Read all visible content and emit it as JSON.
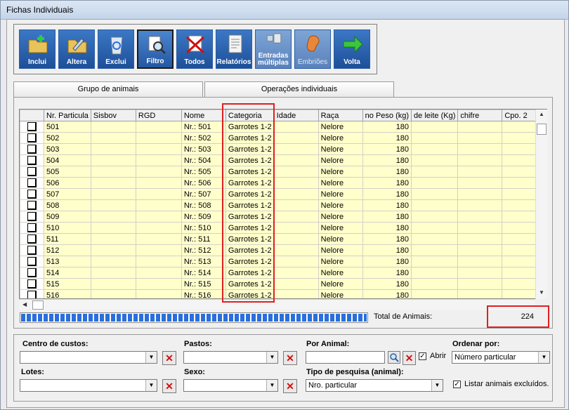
{
  "window": {
    "title": "Fichas Individuais"
  },
  "toolbar": {
    "buttons": [
      {
        "label": "Inclui",
        "icon": "folder-add-icon"
      },
      {
        "label": "Altera",
        "icon": "folder-edit-icon"
      },
      {
        "label": "Exclui",
        "icon": "recycle-bin-icon"
      },
      {
        "label": "Filtro",
        "icon": "filter-magnifier-icon"
      },
      {
        "label": "Todos",
        "icon": "cross-document-icon"
      },
      {
        "label": "Relatórios",
        "icon": "report-icon"
      },
      {
        "label": "Entradas múltiplas",
        "icon": "multiple-entries-icon"
      },
      {
        "label": "Embriões",
        "icon": "embryo-icon"
      },
      {
        "label": "Volta",
        "icon": "arrow-right-icon"
      }
    ]
  },
  "tabs": [
    {
      "label": "Grupo de animais"
    },
    {
      "label": "Operações individuais"
    }
  ],
  "grid": {
    "columns": [
      "Nr. Particula",
      "Sisbov",
      "RGD",
      "Nome",
      "Categoria",
      "Idade",
      "Raça",
      "no Peso (kg)",
      "de leite (Kg)",
      "chifre",
      "Cpo. 2"
    ],
    "rows": [
      {
        "nr": "501",
        "nome": "Nr.: 501",
        "categoria": "Garrotes 1-2",
        "raca": "Nelore",
        "peso": "180"
      },
      {
        "nr": "502",
        "nome": "Nr.: 502",
        "categoria": "Garrotes 1-2",
        "raca": "Nelore",
        "peso": "180"
      },
      {
        "nr": "503",
        "nome": "Nr.: 503",
        "categoria": "Garrotes 1-2",
        "raca": "Nelore",
        "peso": "180"
      },
      {
        "nr": "504",
        "nome": "Nr.: 504",
        "categoria": "Garrotes 1-2",
        "raca": "Nelore",
        "peso": "180"
      },
      {
        "nr": "505",
        "nome": "Nr.: 505",
        "categoria": "Garrotes 1-2",
        "raca": "Nelore",
        "peso": "180"
      },
      {
        "nr": "506",
        "nome": "Nr.: 506",
        "categoria": "Garrotes 1-2",
        "raca": "Nelore",
        "peso": "180"
      },
      {
        "nr": "507",
        "nome": "Nr.: 507",
        "categoria": "Garrotes 1-2",
        "raca": "Nelore",
        "peso": "180"
      },
      {
        "nr": "508",
        "nome": "Nr.: 508",
        "categoria": "Garrotes 1-2",
        "raca": "Nelore",
        "peso": "180"
      },
      {
        "nr": "509",
        "nome": "Nr.: 509",
        "categoria": "Garrotes 1-2",
        "raca": "Nelore",
        "peso": "180"
      },
      {
        "nr": "510",
        "nome": "Nr.: 510",
        "categoria": "Garrotes 1-2",
        "raca": "Nelore",
        "peso": "180"
      },
      {
        "nr": "511",
        "nome": "Nr.: 511",
        "categoria": "Garrotes 1-2",
        "raca": "Nelore",
        "peso": "180"
      },
      {
        "nr": "512",
        "nome": "Nr.: 512",
        "categoria": "Garrotes 1-2",
        "raca": "Nelore",
        "peso": "180"
      },
      {
        "nr": "513",
        "nome": "Nr.: 513",
        "categoria": "Garrotes 1-2",
        "raca": "Nelore",
        "peso": "180"
      },
      {
        "nr": "514",
        "nome": "Nr.: 514",
        "categoria": "Garrotes 1-2",
        "raca": "Nelore",
        "peso": "180"
      },
      {
        "nr": "515",
        "nome": "Nr.: 515",
        "categoria": "Garrotes 1-2",
        "raca": "Nelore",
        "peso": "180"
      },
      {
        "nr": "516",
        "nome": "Nr.: 516",
        "categoria": "Garrotes 1-2",
        "raca": "Nelore",
        "peso": "180"
      }
    ]
  },
  "status": {
    "total_label": "Total de Animais:",
    "total_value": "224",
    "progress": 1.0
  },
  "filters": {
    "centro_label": "Centro de custos:",
    "pastos_label": "Pastos:",
    "por_animal_label": "Por Animal:",
    "abrir_label": "Abrir",
    "ordenar_label": "Ordenar por:",
    "ordenar_value": "Número particular",
    "lotes_label": "Lotes:",
    "sexo_label": "Sexo:",
    "tipo_label": "Tipo de pesquisa (animal):",
    "tipo_value": "Nro. particular",
    "listar_label": "Listar animais excluídos."
  },
  "colors": {
    "accent": "#1e4f99",
    "highlight": "#e02020",
    "cell": "#ffffcc"
  }
}
